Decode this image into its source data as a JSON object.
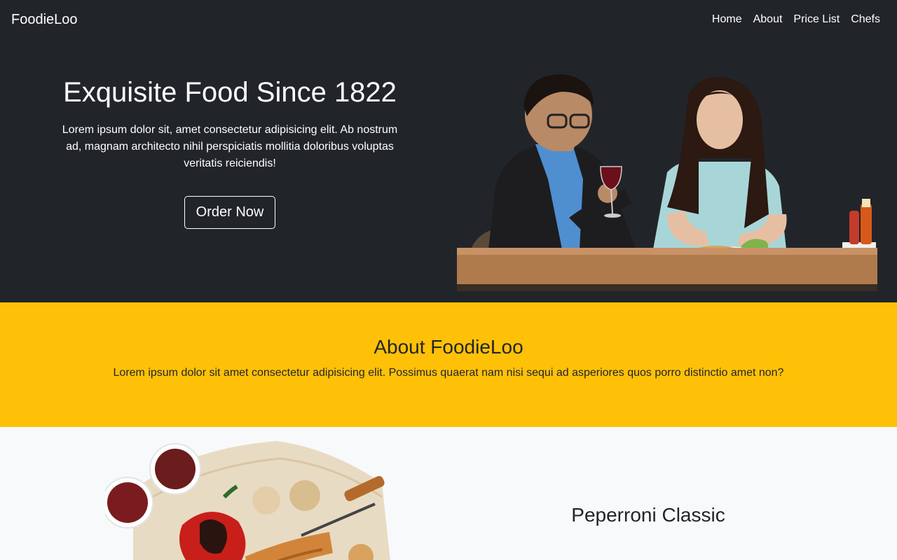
{
  "navbar": {
    "brand": "FoodieLoo",
    "links": [
      "Home",
      "About",
      "Price List",
      "Chefs"
    ]
  },
  "hero": {
    "title": "Exquisite Food Since 1822",
    "lead": "Lorem ipsum dolor sit, amet consectetur adipisicing elit. Ab nostrum ad, magnam architecto nihil perspiciatis mollitia doloribus voluptas veritatis reiciendis!",
    "button_label": "Order Now"
  },
  "about": {
    "title": "About FoodieLoo",
    "text": "Lorem ipsum dolor sit amet consectetur adipisicing elit. Possimus quaerat nam nisi sequi ad asperiores quos porro distinctio amet non?"
  },
  "product": {
    "title": "Peperroni Classic"
  },
  "colors": {
    "dark": "#212529",
    "accent": "#ffc107",
    "light": "#f8f9fa"
  }
}
